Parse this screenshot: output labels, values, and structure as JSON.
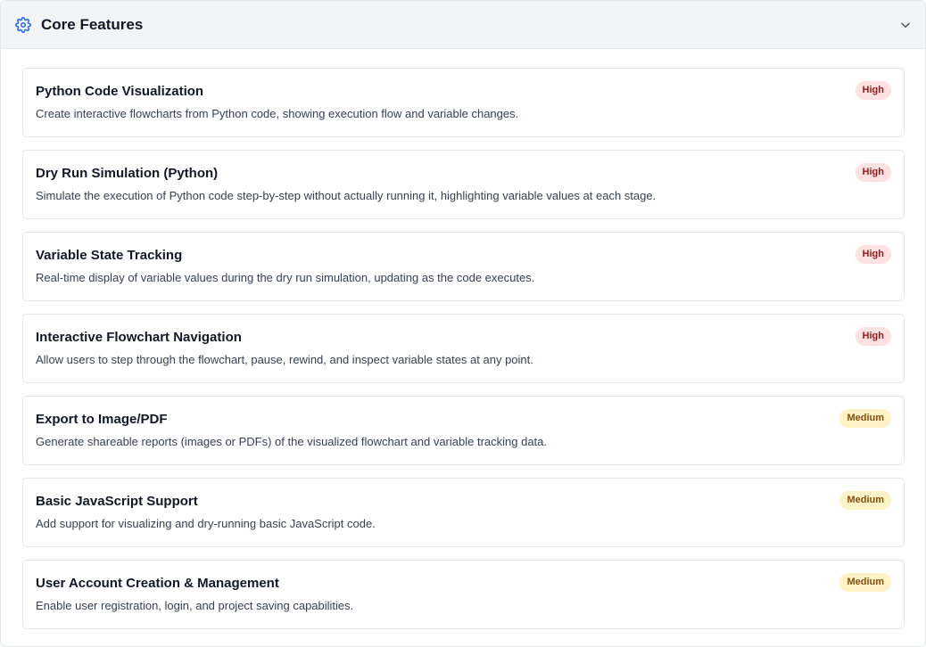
{
  "section": {
    "title": "Core Features",
    "header_icon": "gear-icon",
    "toggle_icon": "chevron-down-icon",
    "colors": {
      "icon": "#2563eb",
      "high_bg": "#fee2e2",
      "high_text": "#991b1b",
      "medium_bg": "#fef3c7",
      "medium_text": "#854d0e"
    }
  },
  "features": [
    {
      "name": "Python Code Visualization",
      "description": "Create interactive flowcharts from Python code, showing execution flow and variable changes.",
      "priority": "High"
    },
    {
      "name": "Dry Run Simulation (Python)",
      "description": "Simulate the execution of Python code step-by-step without actually running it, highlighting variable values at each stage.",
      "priority": "High"
    },
    {
      "name": "Variable State Tracking",
      "description": "Real-time display of variable values during the dry run simulation, updating as the code executes.",
      "priority": "High"
    },
    {
      "name": "Interactive Flowchart Navigation",
      "description": "Allow users to step through the flowchart, pause, rewind, and inspect variable states at any point.",
      "priority": "High"
    },
    {
      "name": "Export to Image/PDF",
      "description": "Generate shareable reports (images or PDFs) of the visualized flowchart and variable tracking data.",
      "priority": "Medium"
    },
    {
      "name": "Basic JavaScript Support",
      "description": "Add support for visualizing and dry-running basic JavaScript code.",
      "priority": "Medium"
    },
    {
      "name": "User Account Creation & Management",
      "description": "Enable user registration, login, and project saving capabilities.",
      "priority": "Medium"
    }
  ]
}
